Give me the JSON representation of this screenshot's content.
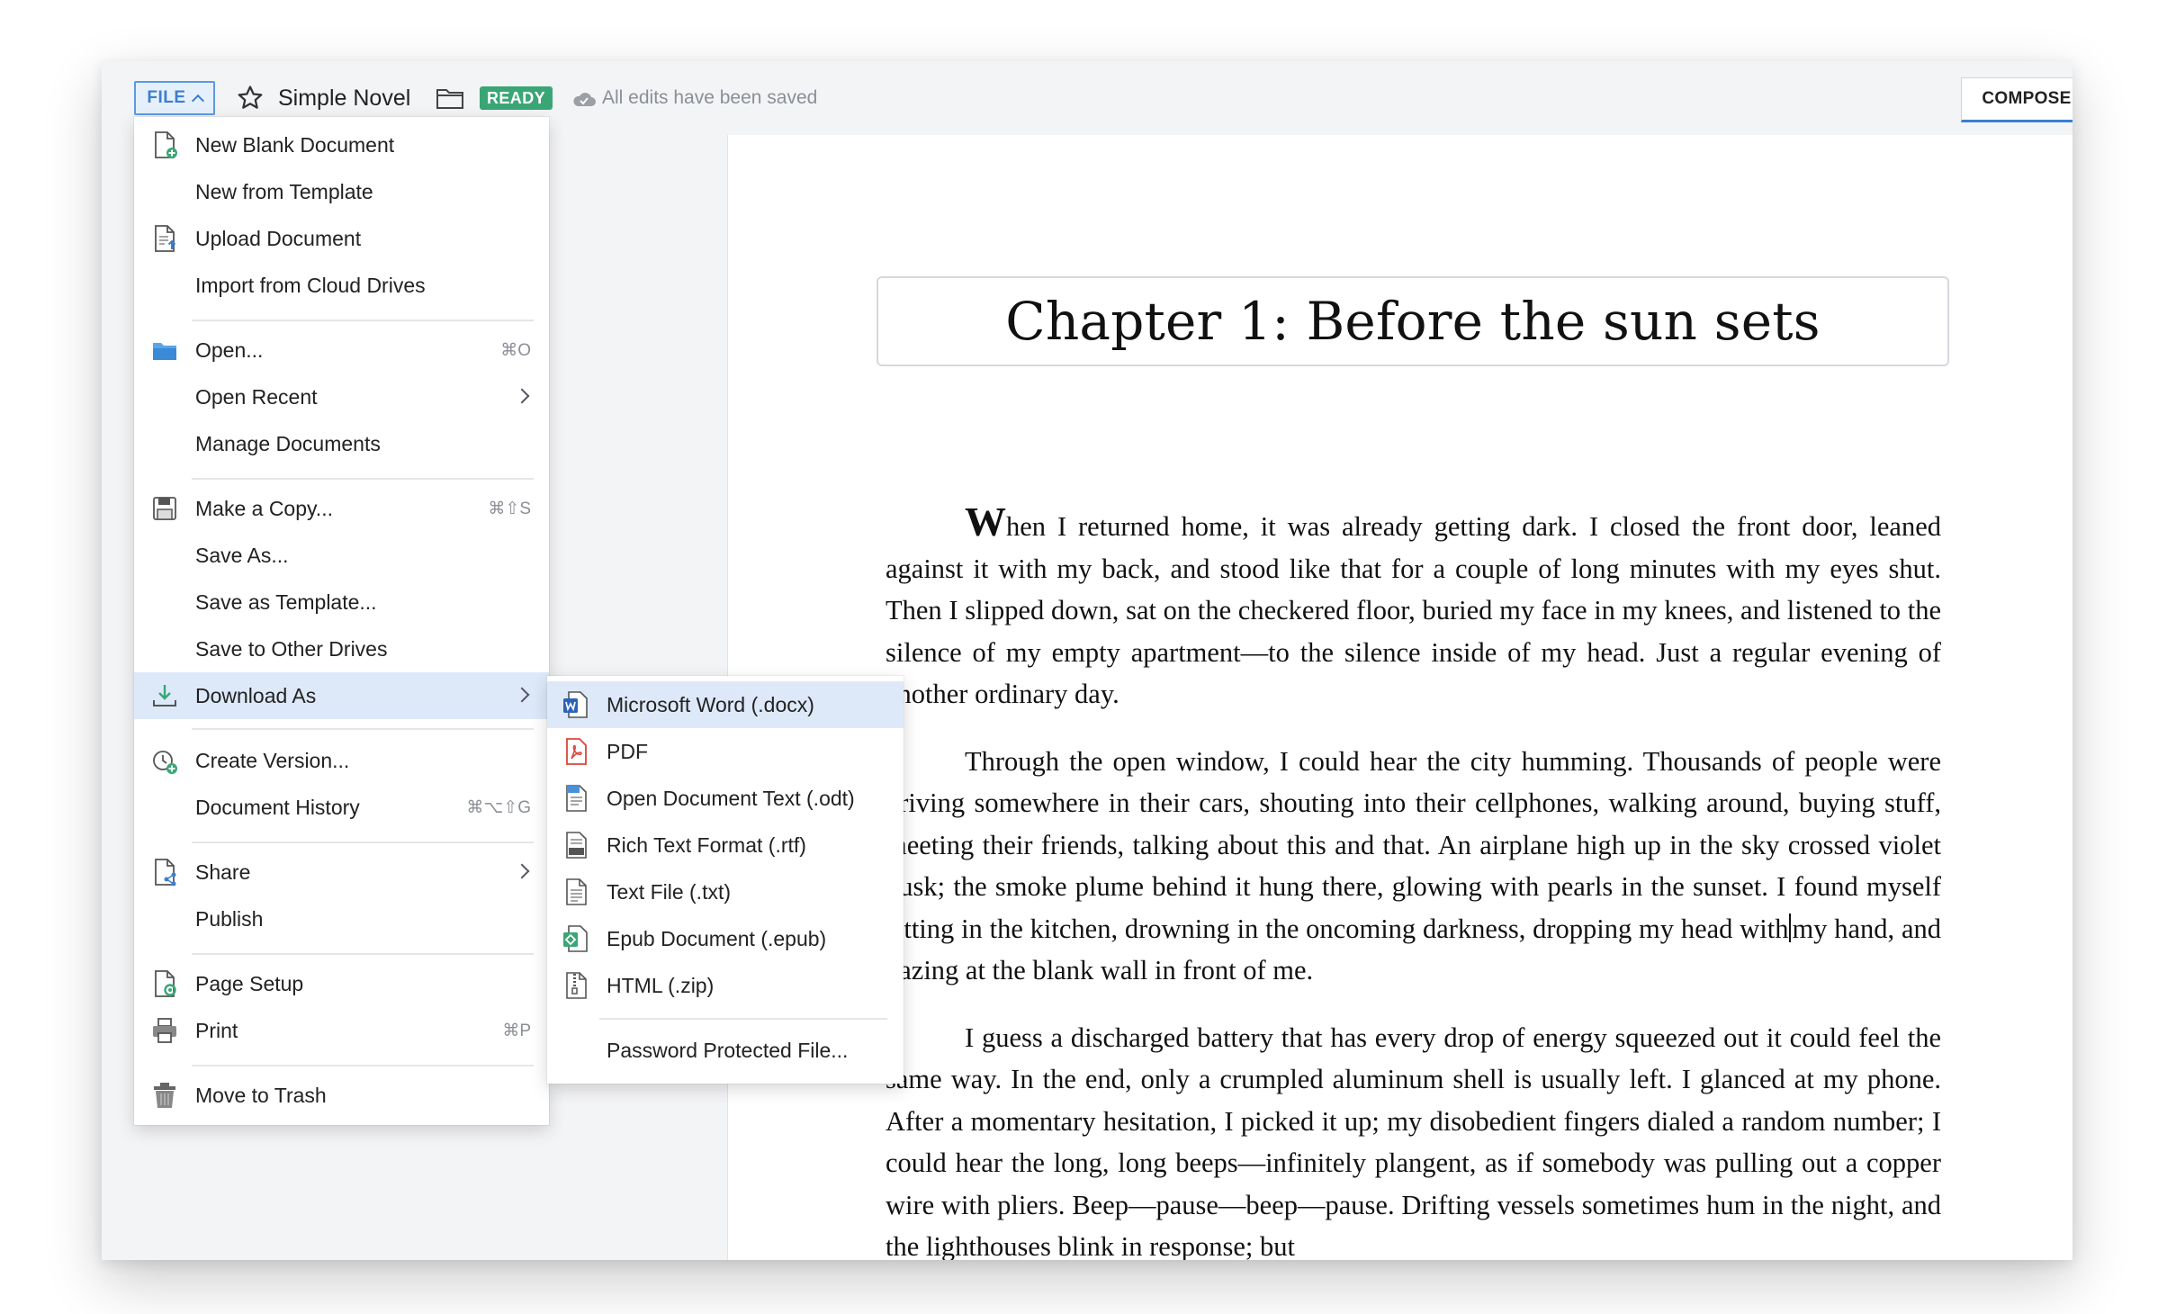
{
  "topbar": {
    "file_label": "FILE",
    "document_title": "Simple Novel",
    "status_badge": "READY",
    "save_status": "All edits have been saved",
    "compose_label": "COMPOSE"
  },
  "file_menu": {
    "new_blank": {
      "label": "New Blank Document"
    },
    "new_template": {
      "label": "New from Template"
    },
    "upload": {
      "label": "Upload Document"
    },
    "import_cloud": {
      "label": "Import from Cloud Drives"
    },
    "open": {
      "label": "Open...",
      "shortcut": "⌘O"
    },
    "open_recent": {
      "label": "Open Recent"
    },
    "manage": {
      "label": "Manage Documents"
    },
    "make_copy": {
      "label": "Make a Copy...",
      "shortcut": "⌘⇧S"
    },
    "save_as": {
      "label": "Save As..."
    },
    "save_template": {
      "label": "Save as Template..."
    },
    "save_other": {
      "label": "Save to Other Drives"
    },
    "download_as": {
      "label": "Download As"
    },
    "create_version": {
      "label": "Create Version..."
    },
    "doc_history": {
      "label": "Document History",
      "shortcut": "⌘⌥⇧G"
    },
    "share": {
      "label": "Share"
    },
    "publish": {
      "label": "Publish"
    },
    "page_setup": {
      "label": "Page Setup"
    },
    "print": {
      "label": "Print",
      "shortcut": "⌘P"
    },
    "trash": {
      "label": "Move to Trash"
    }
  },
  "download_submenu": {
    "docx": "Microsoft Word (.docx)",
    "pdf": "PDF",
    "odt": "Open Document Text (.odt)",
    "rtf": "Rich Text Format (.rtf)",
    "txt": "Text File (.txt)",
    "epub": "Epub Document (.epub)",
    "html": "HTML (.zip)",
    "password": "Password Protected File..."
  },
  "document": {
    "chapter_title": "Chapter 1: Before the sun sets",
    "p1_dropcap": "W",
    "p1_rest": "hen I returned home, it was already getting dark. I closed the front door, leaned against it with my back, and stood like that for a couple of long minutes with my eyes shut. Then I slipped down, sat on the checkered floor, buried my face in my knees, and listened to the silence of my empty apartment—to the silence inside of my head. Just a regular evening of another ordinary day.",
    "p2_before_caret": "Through the open window, I could hear the city humming. Thousands of people were driving somewhere in their cars, shouting into their cellphones, walking around, buying stuff, meeting their friends, talking about this and that. An airplane high up in the sky crossed violet dusk; the smoke plume behind it hung there, glowing with pearls in the sunset. I found myself sitting in the kitchen, drowning in the oncoming darkness, dropping my head with",
    "p2_after_caret": "my hand, and gazing at the blank wall in front of me.",
    "p3": "I guess a discharged battery that has every drop of energy squeezed out it could feel the same way. In the end, only a crumpled aluminum shell is usually left. I glanced at my phone. After a momentary hesitation, I picked it up; my disobedient fingers dialed a random number; I could hear the long, long beeps—infinitely plangent, as if somebody was pulling out a copper wire with pliers. Beep—pause—beep—pause. Drifting vessels sometimes hum in the night, and the lighthouses blink in response; but"
  },
  "colors": {
    "accent": "#3b7fd0",
    "ready_badge": "#3aa676",
    "menu_highlight": "#dde9f9"
  }
}
